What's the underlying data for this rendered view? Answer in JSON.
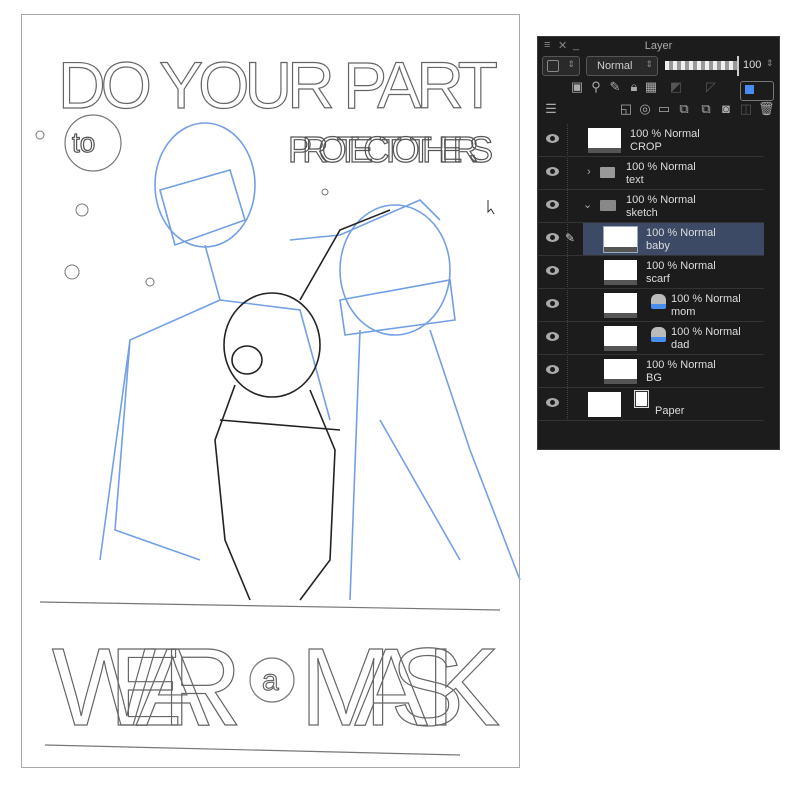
{
  "canvas": {
    "headline": "DO YOUR PART",
    "to": "to",
    "subheadline": "PROTECT OTHERS",
    "footer": "WEAR",
    "footer_a": "a",
    "footer2": "MASK",
    "sketch_blue": "#5a8fe0",
    "sketch_black": "#222222"
  },
  "panel": {
    "title": "Layer",
    "blend_mode": "Normal",
    "opacity": "100",
    "layers": [
      {
        "name": "CROP",
        "info": "100 % Normal",
        "type": "raster"
      },
      {
        "name": "text",
        "info": "100 % Normal",
        "type": "folder",
        "expanded": false
      },
      {
        "name": "sketch",
        "info": "100 % Normal",
        "type": "folder",
        "expanded": true
      },
      {
        "name": "baby",
        "info": "100 % Normal",
        "type": "raster",
        "selected": true
      },
      {
        "name": "scarf",
        "info": "100 % Normal",
        "type": "raster"
      },
      {
        "name": "mom",
        "info": "100 % Normal",
        "type": "vector"
      },
      {
        "name": "dad",
        "info": "100 % Normal",
        "type": "vector"
      },
      {
        "name": "BG",
        "info": "100 % Normal",
        "type": "raster"
      },
      {
        "name": "Paper",
        "info": "",
        "type": "paper"
      }
    ]
  }
}
